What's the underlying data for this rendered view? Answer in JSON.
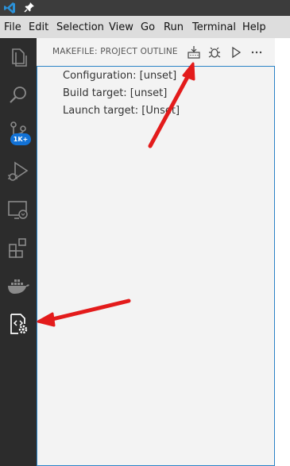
{
  "titlebar": {
    "logo_icon": "vscode-logo-icon",
    "pin_icon": "pin-icon"
  },
  "menu": [
    "File",
    "Edit",
    "Selection",
    "View",
    "Go",
    "Run",
    "Terminal",
    "Help"
  ],
  "activity_bar": {
    "items": [
      "explorer-icon",
      "search-icon",
      "source-control-icon",
      "run-debug-icon",
      "remote-explorer-icon",
      "extensions-icon",
      "docker-icon",
      "makefile-tools-icon"
    ],
    "scm_badge": "1K+"
  },
  "sidebar": {
    "title": "MAKEFILE: PROJECT OUTLINE",
    "actions": [
      "build-icon",
      "debug-icon",
      "run-icon",
      "more-actions-icon"
    ],
    "tree": [
      "Configuration: [unset]",
      "Build target: [unset]",
      "Launch target: [Unset]"
    ]
  },
  "annotations": {
    "arrow_color": "#e31b1b"
  }
}
